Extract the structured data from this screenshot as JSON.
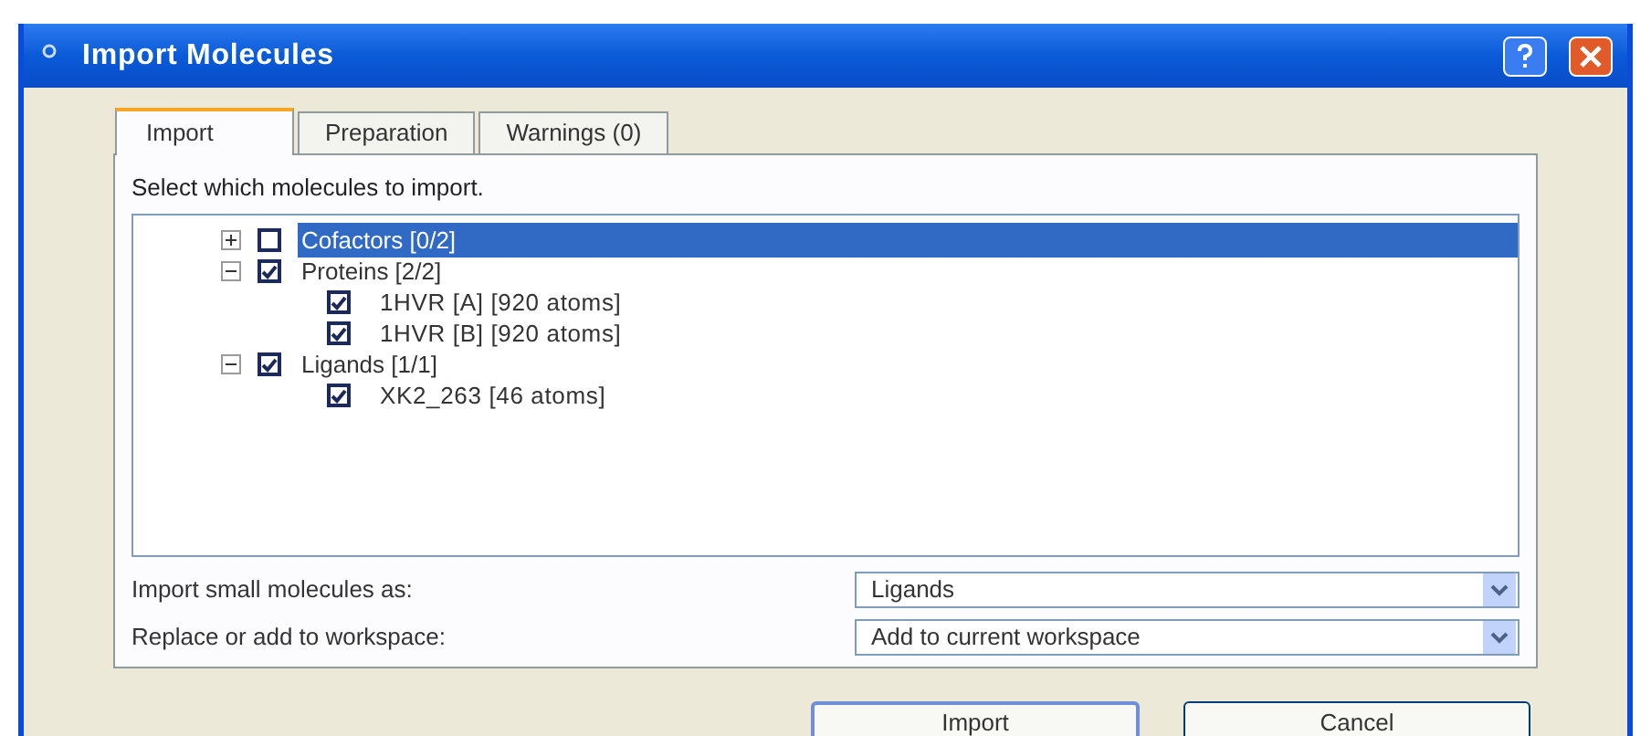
{
  "window": {
    "title": "Import Molecules"
  },
  "tabs": [
    {
      "label": "Import",
      "selected": true
    },
    {
      "label": "Preparation",
      "selected": false
    },
    {
      "label": "Warnings (0)",
      "selected": false
    }
  ],
  "instruction": "Select which molecules to import.",
  "tree": [
    {
      "label": "Cofactors [0/2]",
      "checked": false,
      "expanded": false,
      "selected": true
    },
    {
      "label": "Proteins [2/2]",
      "checked": true,
      "expanded": true,
      "selected": false,
      "children": [
        {
          "label": "1HVR [A] [920 atoms]",
          "checked": true,
          "selected": false
        },
        {
          "label": "1HVR [B] [920 atoms]",
          "checked": true,
          "selected": false
        }
      ]
    },
    {
      "label": "Ligands [1/1]",
      "checked": true,
      "expanded": true,
      "selected": false,
      "children": [
        {
          "label": "XK2_263 [46 atoms]",
          "checked": true,
          "selected": false
        }
      ]
    }
  ],
  "options": [
    {
      "label": "Import small molecules as:",
      "value": "Ligands"
    },
    {
      "label": "Replace or add to workspace:",
      "value": "Add to current workspace"
    }
  ],
  "buttons": [
    "Import",
    "Cancel"
  ]
}
